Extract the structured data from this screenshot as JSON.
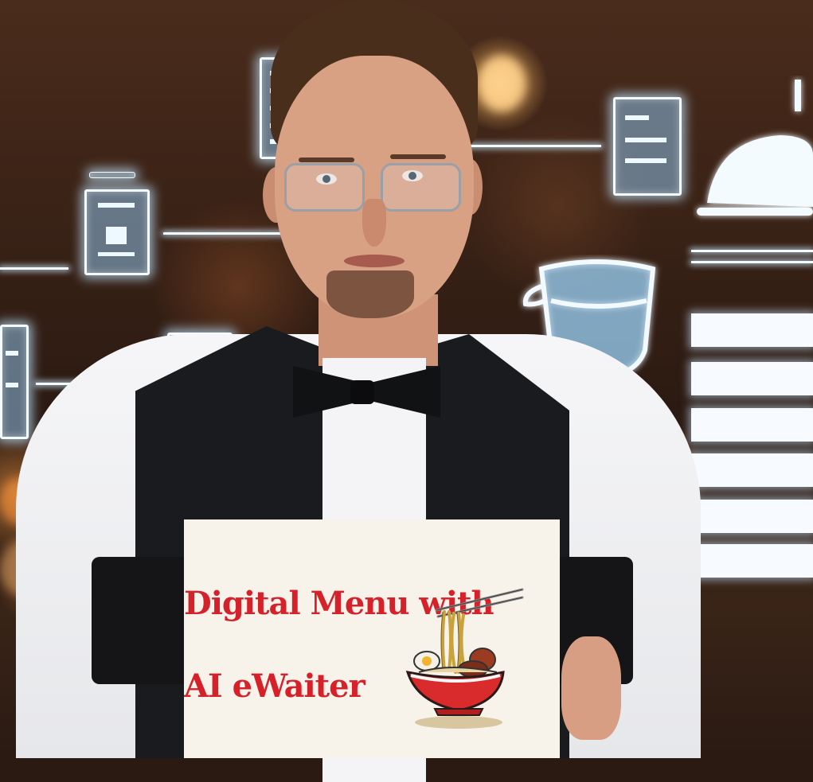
{
  "card": {
    "title_line1": "Digital Menu with",
    "title_line2": "AI eWaiter"
  },
  "colors": {
    "title": "#d6202a",
    "card_background": "#f7f2ea",
    "hologram": "#eef8ff",
    "bowl": "#d92b2b"
  },
  "icons": [
    "menu-card-icon",
    "tablet-icon",
    "coffee-cup-icon",
    "cloche-icon",
    "ramen-bowl-icon"
  ]
}
